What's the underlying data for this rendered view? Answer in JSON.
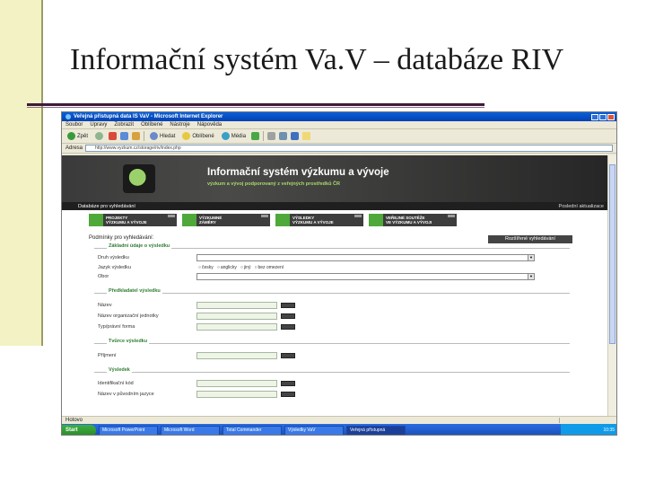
{
  "slide": {
    "title": "Informační systém Va.V – databáze RIV"
  },
  "browser": {
    "window_title": "Veřejná přístupná data IS VaV - Microsoft Internet Explorer",
    "menu": [
      "Soubor",
      "Úpravy",
      "Zobrazit",
      "Oblíbené",
      "Nástroje",
      "Nápověda"
    ],
    "toolbar": {
      "back": "Zpět",
      "search": "Hledat",
      "favorites": "Oblíbené",
      "media": "Média"
    },
    "address_label": "Adresa",
    "address_value": "http://www.vyzkum.cz/storage/riv/index.php",
    "go_label": "Přejít",
    "status_text": "Hotovo"
  },
  "site": {
    "banner_title": "Informační systém výzkumu a vývoje",
    "banner_subtitle": "výzkum a vývoj podporovaný z veřejných prostředků ČR",
    "db_bar_label": "Databáze pro vyhledávání",
    "db_bar_right": "Poslední aktualizace",
    "tabs": [
      {
        "line1": "PROJEKTY",
        "line2": "VÝZKUMU A VÝVOJE"
      },
      {
        "line1": "VÝZKUMNÉ",
        "line2": "ZÁMĚRY"
      },
      {
        "line1": "VÝSLEDKY",
        "line2": "VÝZKUMU A VÝVOJE"
      },
      {
        "line1": "VEŘEJNÉ SOUTĚŽE",
        "line2": "VE VÝZKUMU A VÝVOJI"
      }
    ]
  },
  "form": {
    "title": "Podmínky pro vyhledávání:",
    "advanced_button": "Rozšířené vyhledávání",
    "section_basic": "Základní údaje o výsledku",
    "label_druh": "Druh výsledku",
    "label_jazyk": "Jazyk výsledku",
    "language_options": [
      "česky",
      "anglicky",
      "jiný",
      "bez omezení"
    ],
    "label_obor": "Obor",
    "section_predkladatel": "Předkladatel výsledku",
    "label_nazev": "Název",
    "label_org": "Název organizační jednotky",
    "label_typ": "Typ/právní forma",
    "section_tvurce": "Tvůrce výsledku",
    "label_prijmeni": "Příjmení",
    "section_vysledek": "Výsledek",
    "label_id": "Identifikační kód",
    "label_nazev_jazyk": "Název v původním jazyce"
  },
  "taskbar": {
    "start": "Start",
    "tasks": [
      "Microsoft PowerPoint",
      "Microsoft Word",
      "Total Commander",
      "Výsledky VaV",
      "Veřejná přístupná"
    ],
    "clock": "10:35"
  },
  "colors": {
    "accent_green": "#4fa83a",
    "banner_dark": "#2f2f2f",
    "xp_blue": "#0a5fd8"
  }
}
